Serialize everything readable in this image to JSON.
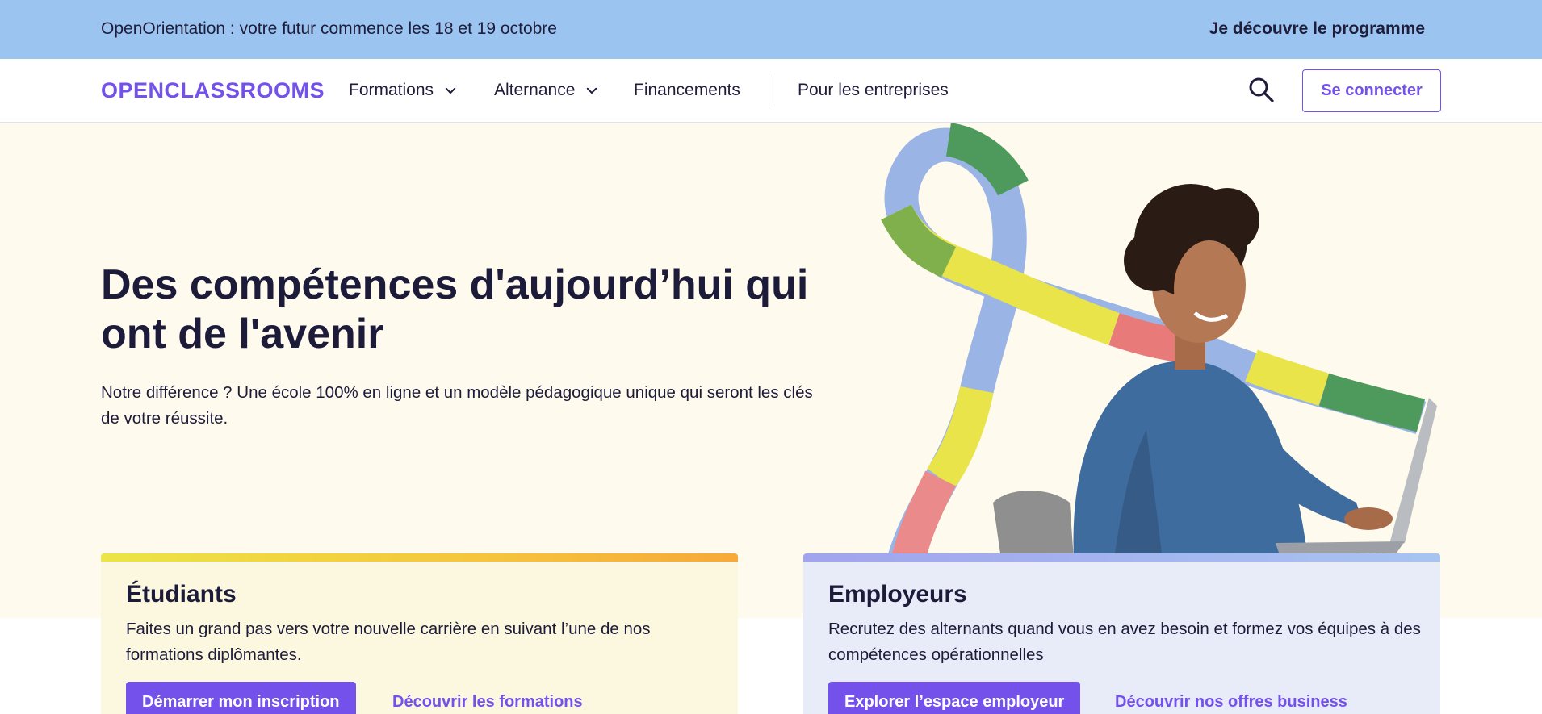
{
  "promo": {
    "text": "OpenOrientation : votre futur commence les 18 et 19 octobre",
    "link": "Je découvre le programme"
  },
  "nav": {
    "logo": "OPENCLASSROOMS",
    "items": [
      {
        "label": "Formations",
        "has_dropdown": true
      },
      {
        "label": "Alternance",
        "has_dropdown": true
      },
      {
        "label": "Financements",
        "has_dropdown": false
      },
      {
        "label": "Pour les entreprises",
        "has_dropdown": false
      }
    ],
    "search_icon": "search-icon",
    "login_label": "Se connecter"
  },
  "hero": {
    "title": "Des compétences d'aujourd’hui qui ont de l'avenir",
    "description": "Notre différence ? Une école 100% en ligne et un modèle pédagogique unique qui seront les clés de votre réussite."
  },
  "cards": {
    "students": {
      "title": "Étudiants",
      "description": "Faites un grand pas vers votre nouvelle carrière en suivant l’une de nos formations diplômantes.",
      "primary_label": "Démarrer mon inscription",
      "link_label": "Découvrir les formations"
    },
    "employers": {
      "title": "Employeurs",
      "description": "Recrutez des alternants quand vous en avez besoin et formez vos équipes à des compétences opérationnelles",
      "primary_label": "Explorer l’espace employeur",
      "link_label": "Découvrir nos offres business"
    }
  },
  "colors": {
    "brand": "#7451eb",
    "promo_bg": "#9bc4f0",
    "hero_bg": "#fefaed",
    "students_bg": "#fcf8df",
    "employers_bg": "#e8ecf8",
    "text": "#1d1b3a"
  }
}
